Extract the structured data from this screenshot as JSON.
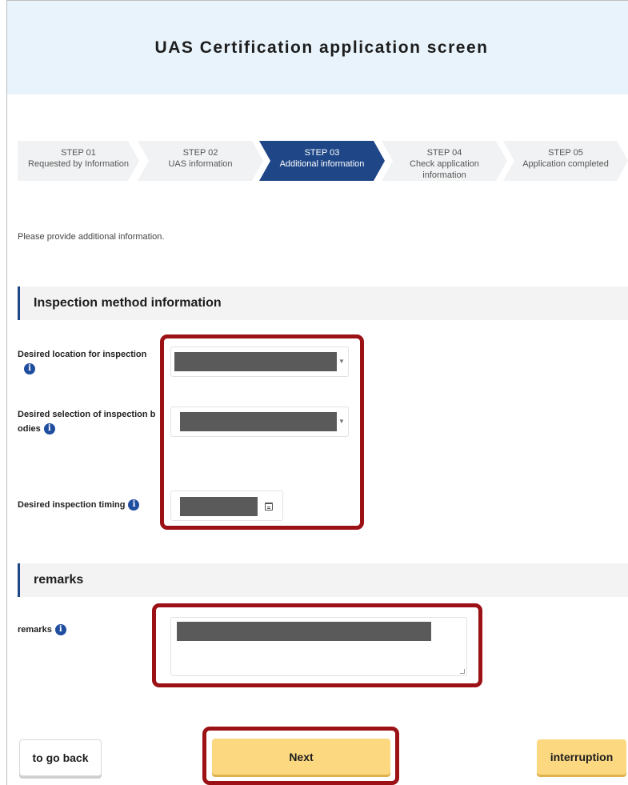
{
  "header": {
    "title": "UAS Certification application screen"
  },
  "steps": [
    {
      "num": "STEP 01",
      "label": "Requested by Information"
    },
    {
      "num": "STEP 02",
      "label": "UAS information"
    },
    {
      "num": "STEP 03",
      "label": "Additional information"
    },
    {
      "num": "STEP 04",
      "label": "Check application information"
    },
    {
      "num": "STEP 05",
      "label": "Application completed"
    }
  ],
  "active_step": 3,
  "intro": "Please provide additional information.",
  "inspection_section": {
    "title": "Inspection method information",
    "location_label": "Desired location for inspection",
    "bodies_label_line1": "Desired selection of inspection b",
    "bodies_label_line2": "odies",
    "timing_label": "Desired inspection timing"
  },
  "remarks_section": {
    "title": "remarks",
    "field_label": "remarks"
  },
  "icons": {
    "info": "info-icon",
    "caret": "chevron-down-icon",
    "calendar": "calendar-icon",
    "info_glyph": "i",
    "caret_glyph": "▼"
  },
  "buttons": {
    "back": "to go back",
    "next": "Next",
    "interruption": "interruption"
  },
  "colors": {
    "accent": "#1f4788",
    "highlight": "#9b1116",
    "primary_button": "#fcd880",
    "header_bg": "#e8f3fb",
    "redaction": "#5a5a5a"
  }
}
